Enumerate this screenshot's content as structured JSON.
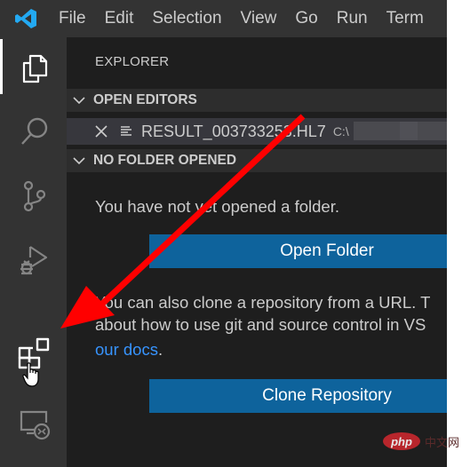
{
  "titlebar": {
    "logo_icon": "vscode-logo-icon",
    "menu": [
      "File",
      "Edit",
      "Selection",
      "View",
      "Go",
      "Run",
      "Terminal"
    ],
    "menu_visible": [
      "File",
      "Edit",
      "Selection",
      "View",
      "Go",
      "Run",
      "Term"
    ]
  },
  "activitybar": {
    "items": [
      {
        "name": "explorer",
        "icon": "files-icon",
        "active": true
      },
      {
        "name": "search",
        "icon": "search-icon",
        "active": false
      },
      {
        "name": "source-control",
        "icon": "source-control-icon",
        "active": false
      },
      {
        "name": "run-and-debug",
        "icon": "run-debug-icon",
        "active": false
      },
      {
        "name": "extensions",
        "icon": "extensions-icon",
        "active": false,
        "hovered": true
      },
      {
        "name": "remote-explorer",
        "icon": "remote-explorer-icon",
        "active": false
      }
    ]
  },
  "sidebar": {
    "title": "EXPLORER",
    "open_editors": {
      "header": "OPEN EDITORS",
      "files": [
        {
          "name": "RESULT_003733253.HL7",
          "path": "C:\\",
          "icon": "file-lines-icon"
        }
      ]
    },
    "no_folder": {
      "header": "NO FOLDER OPENED",
      "message": "You have not yet opened a folder.",
      "open_folder_label": "Open Folder",
      "clone_message_line1": "You can also clone a repository from a URL. T",
      "clone_message_line2": "about how to use git and source control in VS",
      "docs_link": "our docs",
      "docs_suffix": ".",
      "clone_label": "Clone Repository"
    }
  },
  "annotation": {
    "type": "arrow",
    "color": "#ff0000",
    "points_to": "extensions"
  },
  "watermark": {
    "brand": "php",
    "suffix": "中文网"
  },
  "colors": {
    "titlebar_bg": "#333333",
    "activitybar_bg": "#333333",
    "sidebar_bg": "#1e1e1e",
    "section_bg": "#2d2d2d",
    "selected_row_bg": "#37373d",
    "button_bg": "#0e639c",
    "link": "#3794ff",
    "vscode_blue": "#23a9f2"
  }
}
